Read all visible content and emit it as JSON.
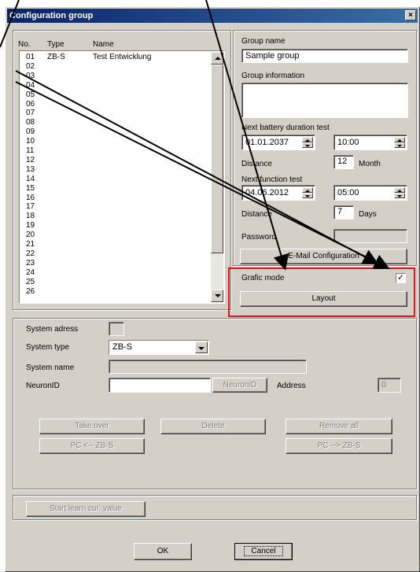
{
  "window": {
    "title": "Configuration group",
    "close_glyph": "×"
  },
  "list": {
    "headers": {
      "no": "No.",
      "type": "Type",
      "name": "Name"
    },
    "rows": [
      {
        "no": "01",
        "type": "ZB-S",
        "name": "Test Entwicklung"
      },
      {
        "no": "02",
        "type": "",
        "name": ""
      },
      {
        "no": "03",
        "type": "",
        "name": ""
      },
      {
        "no": "04",
        "type": "",
        "name": ""
      },
      {
        "no": "05",
        "type": "",
        "name": ""
      },
      {
        "no": "06",
        "type": "",
        "name": ""
      },
      {
        "no": "07",
        "type": "",
        "name": ""
      },
      {
        "no": "08",
        "type": "",
        "name": ""
      },
      {
        "no": "09",
        "type": "",
        "name": ""
      },
      {
        "no": "10",
        "type": "",
        "name": ""
      },
      {
        "no": "11",
        "type": "",
        "name": ""
      },
      {
        "no": "12",
        "type": "",
        "name": ""
      },
      {
        "no": "13",
        "type": "",
        "name": ""
      },
      {
        "no": "14",
        "type": "",
        "name": ""
      },
      {
        "no": "15",
        "type": "",
        "name": ""
      },
      {
        "no": "16",
        "type": "",
        "name": ""
      },
      {
        "no": "17",
        "type": "",
        "name": ""
      },
      {
        "no": "18",
        "type": "",
        "name": ""
      },
      {
        "no": "19",
        "type": "",
        "name": ""
      },
      {
        "no": "20",
        "type": "",
        "name": ""
      },
      {
        "no": "21",
        "type": "",
        "name": ""
      },
      {
        "no": "22",
        "type": "",
        "name": ""
      },
      {
        "no": "23",
        "type": "",
        "name": ""
      },
      {
        "no": "24",
        "type": "",
        "name": ""
      },
      {
        "no": "25",
        "type": "",
        "name": ""
      },
      {
        "no": "26",
        "type": "",
        "name": ""
      }
    ]
  },
  "group": {
    "name_label": "Group name",
    "name_value": "Sample group",
    "info_label": "Group information",
    "info_value": "",
    "battery_label": "Next battery duration test",
    "battery_date": "01.01.2037",
    "battery_time": "10:00",
    "distance_label": "Distance",
    "battery_distance": "12",
    "month_label": "Month",
    "function_label": "Next function test",
    "function_date": "04.06.2012",
    "function_time": "05:00",
    "function_distance": "7",
    "days_label": "Days",
    "password_label": "Password",
    "password_value": "",
    "email_button": "E-Mail Configuration",
    "grafic_label": "Grafic mode",
    "grafic_checked": "✓",
    "layout_button": "Layout"
  },
  "system": {
    "address_label": "System adress",
    "type_label": "System type",
    "type_value": "ZB-S",
    "name_label": "System name",
    "neuron_label": "NeuronID",
    "neuron_button": "NeuronID",
    "address2_label": "Address",
    "address2_value": "0",
    "take_over": "Take over",
    "delete": "Delete",
    "remove_all": "Remove all",
    "pc_from": "PC <-- ZB-S",
    "pc_to": "PC --> ZB-S"
  },
  "bottom": {
    "start_learn": "Start learn cur. value",
    "ok": "OK",
    "cancel": "Cancel"
  },
  "colors": {
    "highlight_box": "#e0151c",
    "title_start": "#0a246a",
    "face": "#d4d0c8"
  }
}
